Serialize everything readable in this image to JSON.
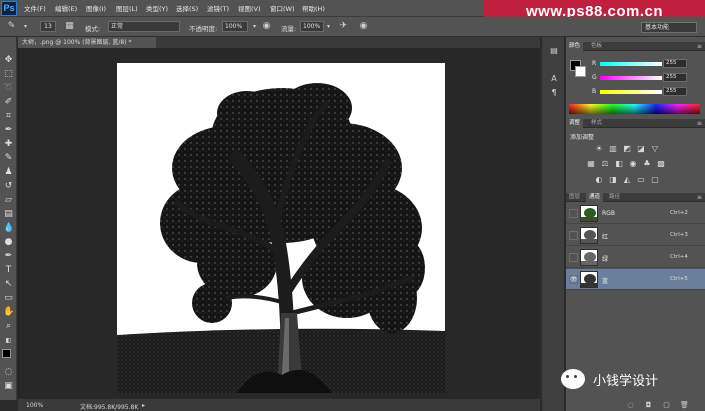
{
  "app": {
    "logo_text": "Ps",
    "menu": [
      "文件(F)",
      "编辑(E)",
      "图像(I)",
      "图层(L)",
      "类型(Y)",
      "选择(S)",
      "滤镜(T)",
      "视图(V)",
      "窗口(W)",
      "帮助(H)"
    ],
    "watermark": "www.ps88.com.cn"
  },
  "options_bar": {
    "brush_size": "13",
    "mode_label": "模式:",
    "mode_value": "正常",
    "opacity_label": "不透明度:",
    "opacity_value": "100%",
    "flow_label": "流量:",
    "flow_value": "100%",
    "workspace": "基本功能"
  },
  "document": {
    "tab_title": "大树，.png @ 100% (背景图层, 蓝/8) *",
    "zoom": "100%",
    "doc_info": "文档:995.8K/995.8K"
  },
  "panels": {
    "color": {
      "tabs": [
        "颜色",
        "色板"
      ],
      "channels": [
        {
          "label": "R",
          "value": "255"
        },
        {
          "label": "G",
          "value": "255"
        },
        {
          "label": "B",
          "value": "255"
        }
      ]
    },
    "adjustments": {
      "tabs": [
        "调整",
        "样式"
      ],
      "title": "添加调整"
    },
    "channels": {
      "tabs": [
        "图层",
        "通道",
        "路径"
      ],
      "items": [
        {
          "name": "RGB",
          "shortcut": "Ctrl+2",
          "selected": false,
          "visible": false
        },
        {
          "name": "红",
          "shortcut": "Ctrl+3",
          "selected": false,
          "visible": false
        },
        {
          "name": "绿",
          "shortcut": "Ctrl+4",
          "selected": false,
          "visible": false
        },
        {
          "name": "蓝",
          "shortcut": "Ctrl+5",
          "selected": true,
          "visible": true
        }
      ]
    }
  },
  "watermark_badge": {
    "text": "小钱学设计"
  },
  "colors": {
    "brand_red": "#c0203e",
    "selection_blue": "#6a7f9c",
    "panel_bg": "#535353",
    "canvas_bg": "#282828"
  }
}
